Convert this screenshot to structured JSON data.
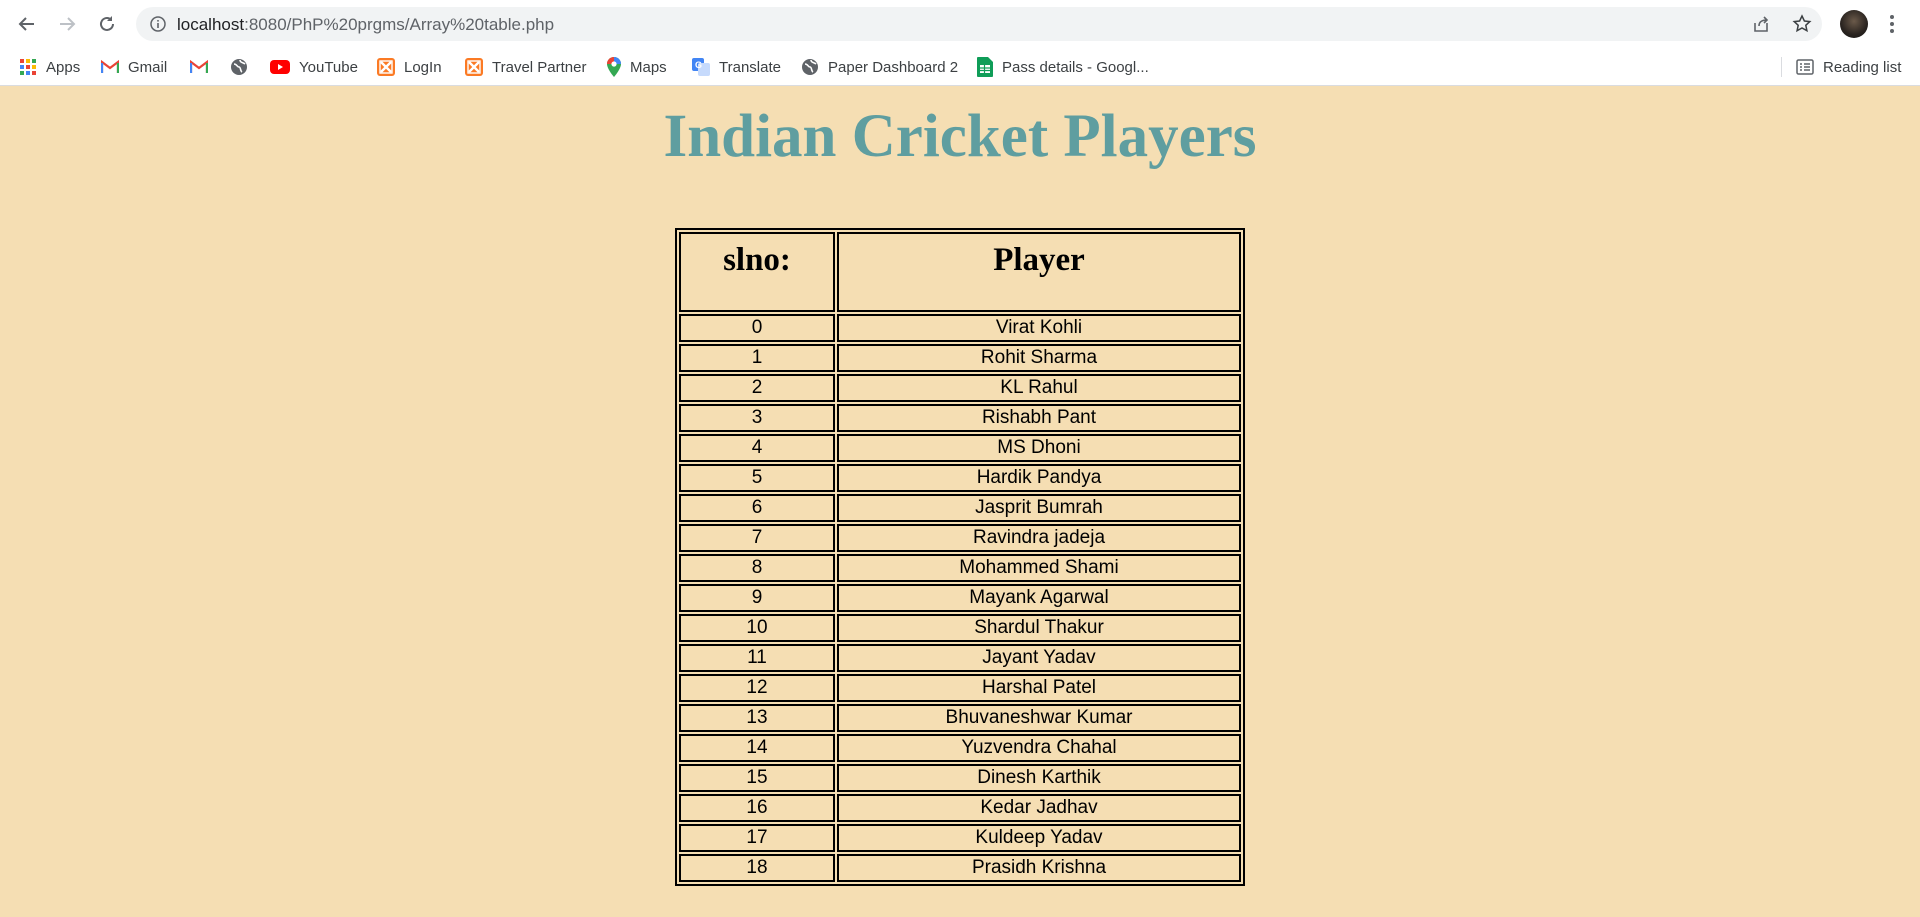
{
  "browser": {
    "url_host": "localhost",
    "url_path": ":8080/PhP%20prgms/Array%20table.php",
    "bookmarks": [
      {
        "label": "Apps",
        "icon": "apps-grid-icon"
      },
      {
        "label": "Gmail",
        "icon": "gmail-icon"
      },
      {
        "label": "",
        "icon": "gmail-icon"
      },
      {
        "label": "",
        "icon": "globe-icon"
      },
      {
        "label": "YouTube",
        "icon": "youtube-icon"
      },
      {
        "label": "LogIn",
        "icon": "xampp-icon"
      },
      {
        "label": "Travel Partner",
        "icon": "xampp-icon"
      },
      {
        "label": "Maps",
        "icon": "maps-pin-icon"
      },
      {
        "label": "Translate",
        "icon": "translate-icon"
      },
      {
        "label": "Paper Dashboard 2",
        "icon": "globe-icon"
      },
      {
        "label": "Pass details - Googl...",
        "icon": "sheets-icon"
      }
    ],
    "reading_list": "Reading list"
  },
  "page": {
    "title": "Indian Cricket Players",
    "headers": [
      "slno:",
      "Player"
    ],
    "rows": [
      [
        "0",
        "Virat Kohli"
      ],
      [
        "1",
        "Rohit Sharma"
      ],
      [
        "2",
        "KL Rahul"
      ],
      [
        "3",
        "Rishabh Pant"
      ],
      [
        "4",
        "MS Dhoni"
      ],
      [
        "5",
        "Hardik Pandya"
      ],
      [
        "6",
        "Jasprit Bumrah"
      ],
      [
        "7",
        "Ravindra jadeja"
      ],
      [
        "8",
        "Mohammed Shami"
      ],
      [
        "9",
        "Mayank Agarwal"
      ],
      [
        "10",
        "Shardul Thakur"
      ],
      [
        "11",
        "Jayant Yadav"
      ],
      [
        "12",
        "Harshal Patel"
      ],
      [
        "13",
        "Bhuvaneshwar Kumar"
      ],
      [
        "14",
        "Yuzvendra Chahal"
      ],
      [
        "15",
        "Dinesh Karthik"
      ],
      [
        "16",
        "Kedar Jadhav"
      ],
      [
        "17",
        "Kuldeep Yadav"
      ],
      [
        "18",
        "Prasidh Krishna"
      ]
    ]
  },
  "colors": {
    "background": "#f5deb3",
    "title": "#5f9ea0"
  }
}
